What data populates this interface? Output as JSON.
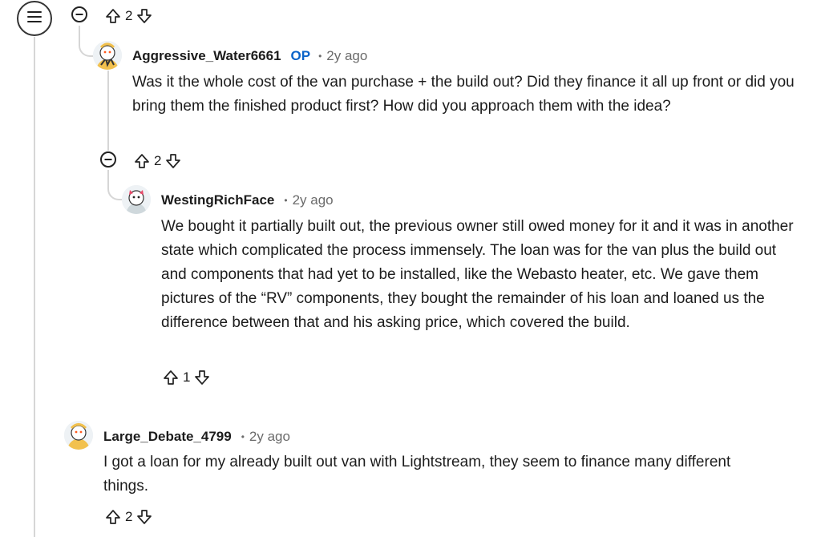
{
  "top": {
    "vote_count": "2"
  },
  "comments": [
    {
      "author": "Aggressive_Water6661",
      "badge": "OP",
      "separator": "•",
      "time": "2y ago",
      "text": "Was it the whole cost of the van purchase + the build out? Did they finance it all up front or did you bring them the finished product first? How did you approach them with the idea?",
      "vote_count": "2"
    },
    {
      "author": "WestingRichFace",
      "separator": "•",
      "time": "2y ago",
      "text": "We bought it partially built out, the previous owner still owed money for it and it was in another state which complicated the process immensely. The loan was for the van plus the build out and components that had yet to be installed, like the Webasto heater, etc. We gave them pictures of the “RV” components, they bought the remainder of his loan and loaned us the difference between that and his asking price, which covered the build.",
      "vote_count": "1"
    },
    {
      "author": "Large_Debate_4799",
      "separator": "•",
      "time": "2y ago",
      "text": "I got a loan for my already built out van with Lightstream, they seem to finance many different things.",
      "vote_count": "2"
    }
  ],
  "colors": {
    "op": "#0a63c9",
    "meta": "#6b6b6b",
    "thread": "#d6d6d6"
  },
  "icons": [
    "menu-icon",
    "collapse-icon",
    "upvote-icon",
    "downvote-icon"
  ]
}
